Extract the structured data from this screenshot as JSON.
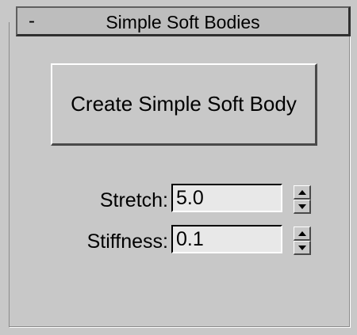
{
  "rollout": {
    "toggle_symbol": "-",
    "title": "Simple Soft Bodies"
  },
  "create_button": {
    "label": "Create Simple Soft Body"
  },
  "fields": {
    "stretch": {
      "label": "Stretch:",
      "value": "5.0"
    },
    "stiffness": {
      "label": "Stiffness:",
      "value": "0.1"
    }
  },
  "icons": {
    "spinner_up": "chevron-up-icon",
    "spinner_down": "chevron-down-icon"
  },
  "colors": {
    "panel_bg": "#c8c8c8",
    "input_bg": "#e8e8e8",
    "header_bg": "#bdbdbd"
  }
}
